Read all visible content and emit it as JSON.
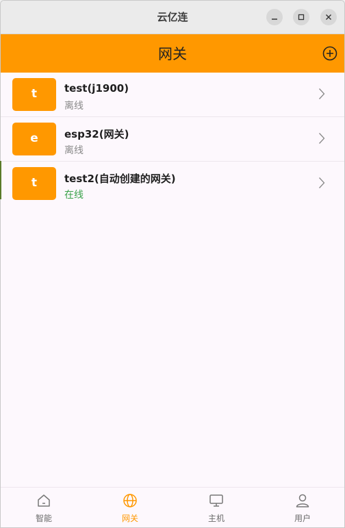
{
  "window": {
    "title": "云亿连"
  },
  "appbar": {
    "title": "网关"
  },
  "gateways": [
    {
      "initial": "t",
      "name": "test(j1900)",
      "status": "离线",
      "online": false
    },
    {
      "initial": "e",
      "name": "esp32(网关)",
      "status": "离线",
      "online": false
    },
    {
      "initial": "t",
      "name": "test2(自动创建的网关)",
      "status": "在线",
      "online": true
    }
  ],
  "nav": [
    {
      "label": "智能",
      "icon": "home-icon",
      "active": false
    },
    {
      "label": "网关",
      "icon": "globe-icon",
      "active": true
    },
    {
      "label": "主机",
      "icon": "monitor-icon",
      "active": false
    },
    {
      "label": "用户",
      "icon": "user-icon",
      "active": false
    }
  ],
  "colors": {
    "accent": "#ff9800",
    "online": "#3aa24a",
    "offline": "#8a8a8a"
  }
}
